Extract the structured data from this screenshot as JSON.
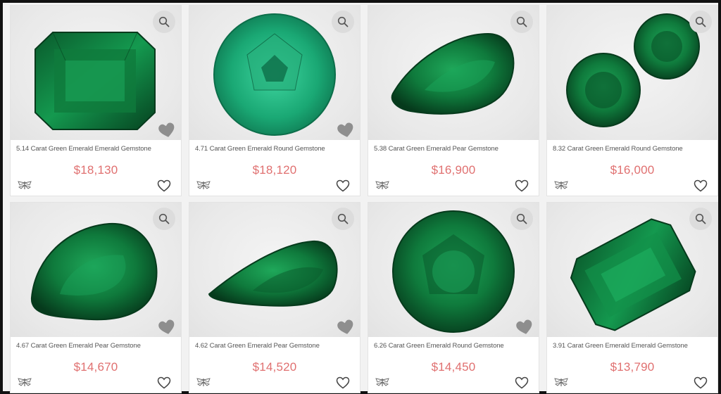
{
  "products": [
    {
      "title": "5.14 Carat Green Emerald Emerald Gemstone",
      "price": "$18,130",
      "shape": "emerald-cut",
      "corner_heart": true
    },
    {
      "title": "4.71 Carat Green Emerald Round Gemstone",
      "price": "$18,120",
      "shape": "round-light",
      "corner_heart": true
    },
    {
      "title": "5.38 Carat Green Emerald Pear Gemstone",
      "price": "$16,900",
      "shape": "pear-tilted",
      "corner_heart": false
    },
    {
      "title": "8.32 Carat Green Emerald Round Gemstone",
      "price": "$16,000",
      "shape": "round-pair",
      "corner_heart": false
    },
    {
      "title": "4.67 Carat Green Emerald Pear Gemstone",
      "price": "$14,670",
      "shape": "pear",
      "corner_heart": true
    },
    {
      "title": "4.62 Carat Green Emerald Pear Gemstone",
      "price": "$14,520",
      "shape": "pear-narrow",
      "corner_heart": true
    },
    {
      "title": "6.26 Carat Green Emerald Round Gemstone",
      "price": "$14,450",
      "shape": "round",
      "corner_heart": true
    },
    {
      "title": "3.91 Carat Green Emerald Emerald Gemstone",
      "price": "$13,790",
      "shape": "emerald-cut-tilted",
      "corner_heart": false
    }
  ],
  "icons": {
    "zoom": "magnifier-icon",
    "favorite": "heart-outline-icon",
    "corner": "heart-filled-icon",
    "brand": "dragonfly-logo-icon"
  },
  "colors": {
    "price": "#e07070",
    "gem_dark": "#0a4a24",
    "gem_mid": "#128a45",
    "gem_light": "#2cc27a"
  }
}
